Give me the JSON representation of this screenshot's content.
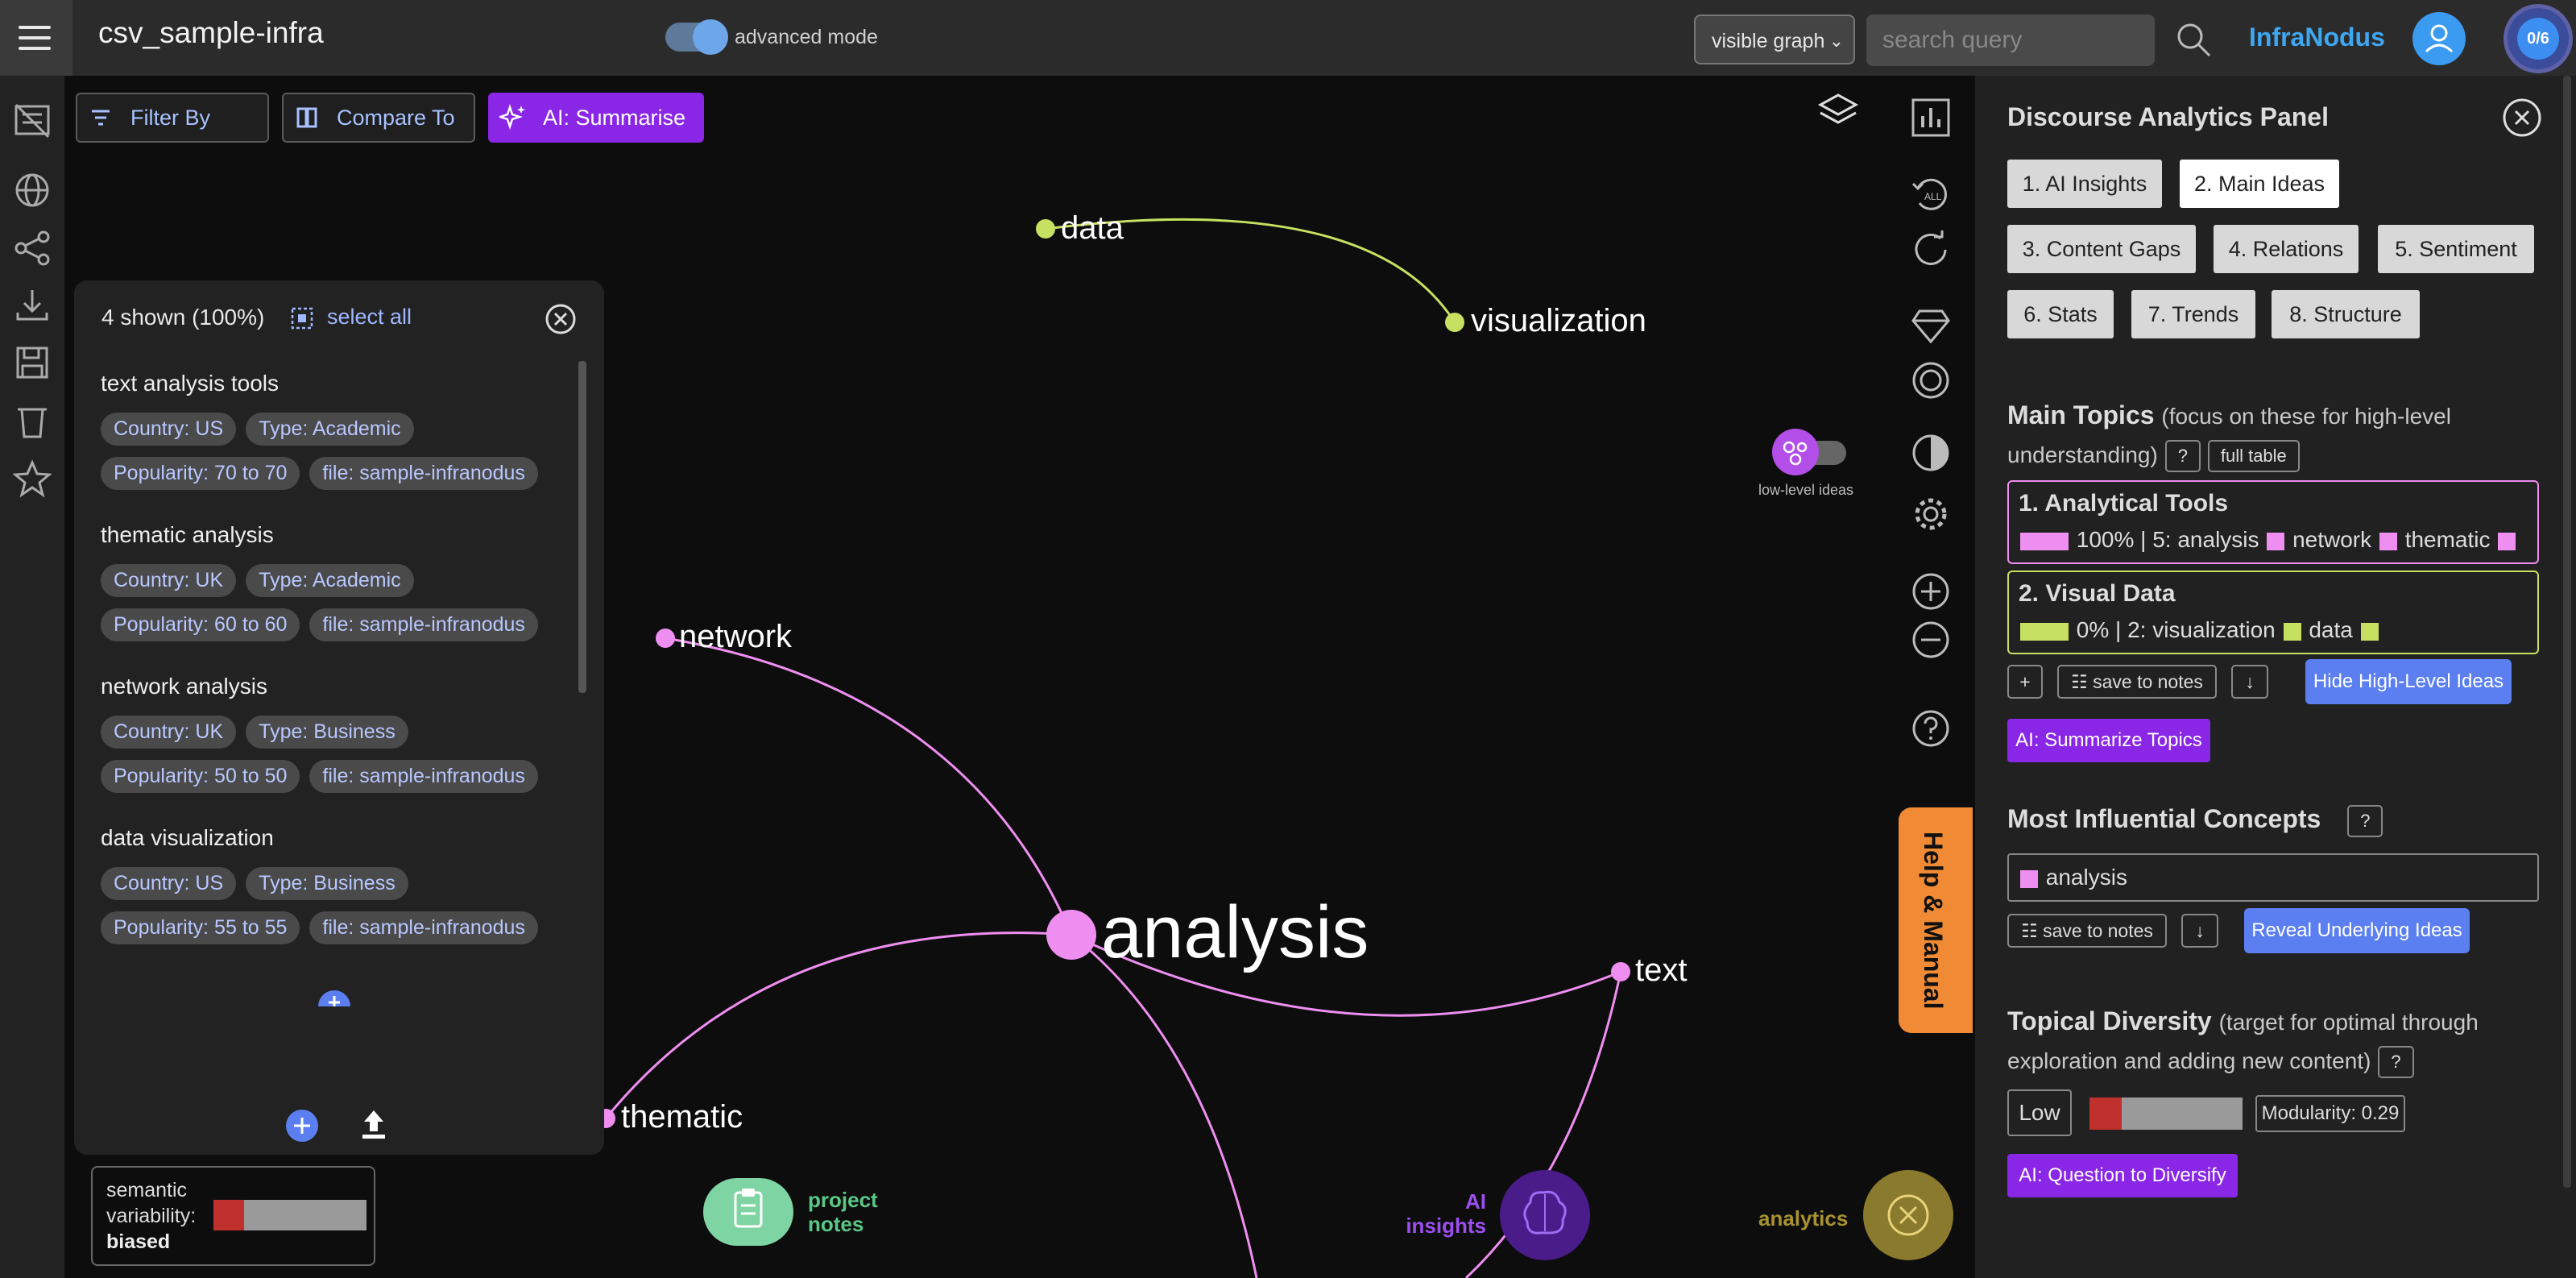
{
  "topbar": {
    "title": "csv_sample-infra",
    "advanced_mode_label": "advanced mode",
    "graph_select_value": "visible graph",
    "search_placeholder": "search query",
    "brand": "InfraNodus",
    "counter": "0/6"
  },
  "toolbar": {
    "filter_label": "Filter By",
    "compare_label": "Compare To",
    "summarise_label": "AI: Summarise"
  },
  "graph": {
    "nodes": [
      {
        "label": "data",
        "color": "#c6e161"
      },
      {
        "label": "visualization",
        "color": "#c6e161"
      },
      {
        "label": "network",
        "color": "#ee8ef0"
      },
      {
        "label": "analysis",
        "color": "#ee8ef0"
      },
      {
        "label": "text",
        "color": "#ee8ef0"
      },
      {
        "label": "thematic",
        "color": "#ee8ef0"
      }
    ],
    "low_level_label": "low-level ideas"
  },
  "filter_panel": {
    "count": "4 shown (100%)",
    "select_all": "select all",
    "items": [
      {
        "title": "text analysis tools",
        "tags": [
          "Country: US",
          "Type: Academic",
          "Popularity: 70 to 70",
          "file: sample-infranodus"
        ]
      },
      {
        "title": "thematic analysis",
        "tags": [
          "Country: UK",
          "Type: Academic",
          "Popularity: 60 to 60",
          "file: sample-infranodus"
        ]
      },
      {
        "title": "network analysis",
        "tags": [
          "Country: UK",
          "Type: Business",
          "Popularity: 50 to 50",
          "file: sample-infranodus"
        ]
      },
      {
        "title": "data visualization",
        "tags": [
          "Country: US",
          "Type: Business",
          "Popularity: 55 to 55",
          "file: sample-infranodus"
        ]
      }
    ]
  },
  "semantic": {
    "line1": "semantic",
    "line2": "variability:",
    "value": "biased",
    "level": 0.2
  },
  "bottom": {
    "project_notes": "project\nnotes",
    "ai_insights": "AI\ninsights",
    "analytics": "analytics"
  },
  "help_manual": "Help & Manual",
  "panel": {
    "title": "Discourse Analytics Panel",
    "tabs": [
      "1. AI Insights",
      "2. Main Ideas",
      "3. Content Gaps",
      "4. Relations",
      "5. Sentiment",
      "6. Stats",
      "7. Trends",
      "8. Structure"
    ],
    "main_topics_heading": "Main Topics",
    "main_topics_sub": "(focus on these for high-level understanding)",
    "q": "?",
    "full_table": "full table",
    "topics": [
      {
        "name": "1. Analytical Tools",
        "stats": "100% | 5: analysis",
        "w2": "network",
        "w3": "thematic",
        "color": "#ee8ef0"
      },
      {
        "name": "2. Visual Data",
        "stats": "0% | 2: visualization",
        "w2": "data",
        "color": "#c6e161"
      }
    ],
    "plus": "+",
    "save_to_notes": "save to notes",
    "down": "↓",
    "hide_high_level": "Hide High-Level Ideas",
    "ai_summarize_topics": "AI: Summarize Topics",
    "influential_heading": "Most Influential Concepts",
    "influential_value": "analysis",
    "reveal_ideas": "Reveal Underlying Ideas",
    "diversity_heading": "Topical Diversity",
    "diversity_sub": "(target for optimal through exploration and adding new content)",
    "diversity_value": "Low",
    "diversity_level": 0.21,
    "modularity": "Modularity: 0.29",
    "ai_question": "AI: Question to Diversify"
  }
}
